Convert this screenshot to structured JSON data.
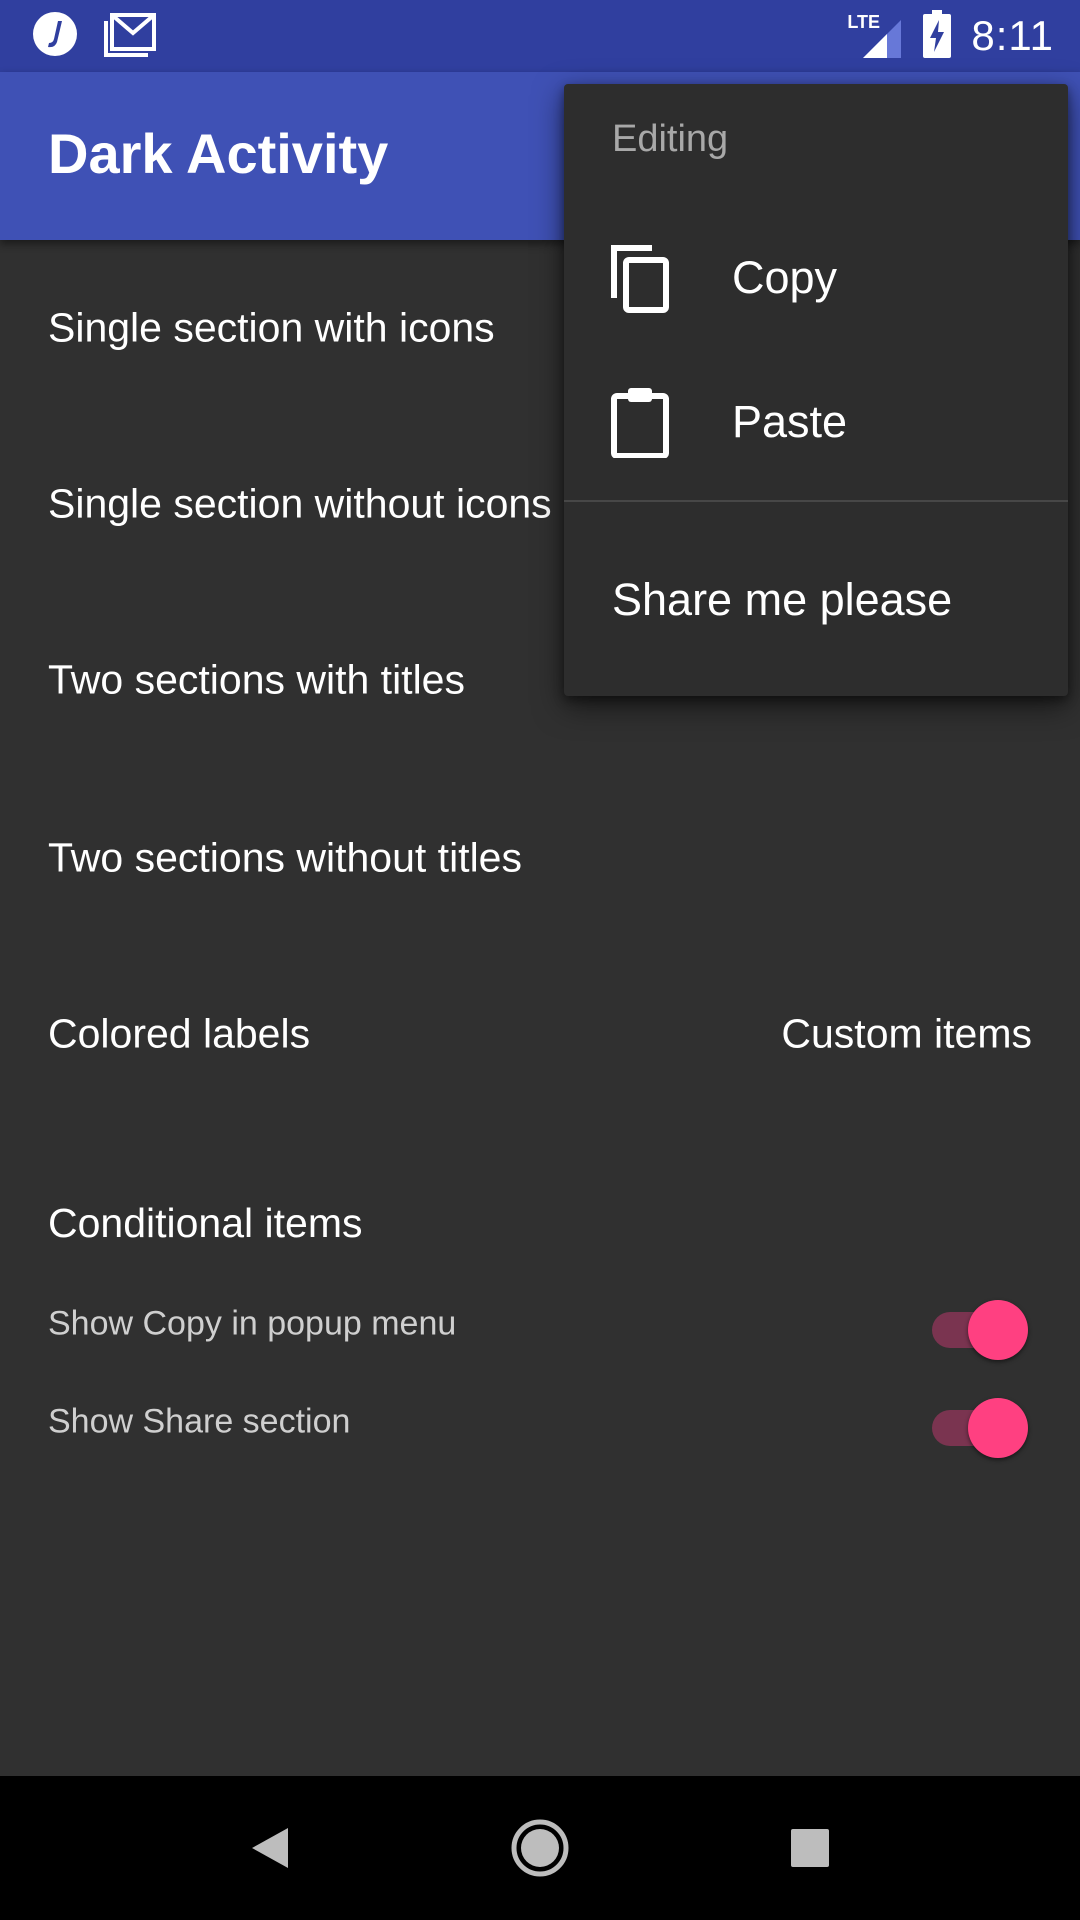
{
  "status_bar": {
    "time": "8:11",
    "network": "LTE",
    "icons": [
      "app-j-icon",
      "gmail-icon",
      "lte-signal-icon",
      "battery-charging-icon"
    ]
  },
  "app_bar": {
    "title": "Dark Activity"
  },
  "list": {
    "items": [
      {
        "label": "Single section with icons"
      },
      {
        "label": "Single section without icons"
      },
      {
        "label": "Two sections with titles"
      },
      {
        "label": "Two sections without titles"
      }
    ],
    "colored_labels": "Colored labels",
    "custom_items": "Custom items"
  },
  "conditional": {
    "title": "Conditional items",
    "switches": [
      {
        "label": "Show Copy in popup menu",
        "checked": true
      },
      {
        "label": "Show Share section",
        "checked": true
      }
    ]
  },
  "popup_menu": {
    "section_title": "Editing",
    "items": [
      {
        "label": "Copy",
        "icon": "copy-icon"
      },
      {
        "label": "Paste",
        "icon": "clipboard-icon"
      }
    ],
    "share_label": "Share me please"
  },
  "nav_bar": {
    "buttons": [
      "back-icon",
      "home-icon",
      "recents-icon"
    ]
  },
  "colors": {
    "status_bar": "#303f9f",
    "app_bar": "#3f51b5",
    "background": "#303030",
    "popup": "#2d2d2d",
    "accent": "#ff4081"
  }
}
